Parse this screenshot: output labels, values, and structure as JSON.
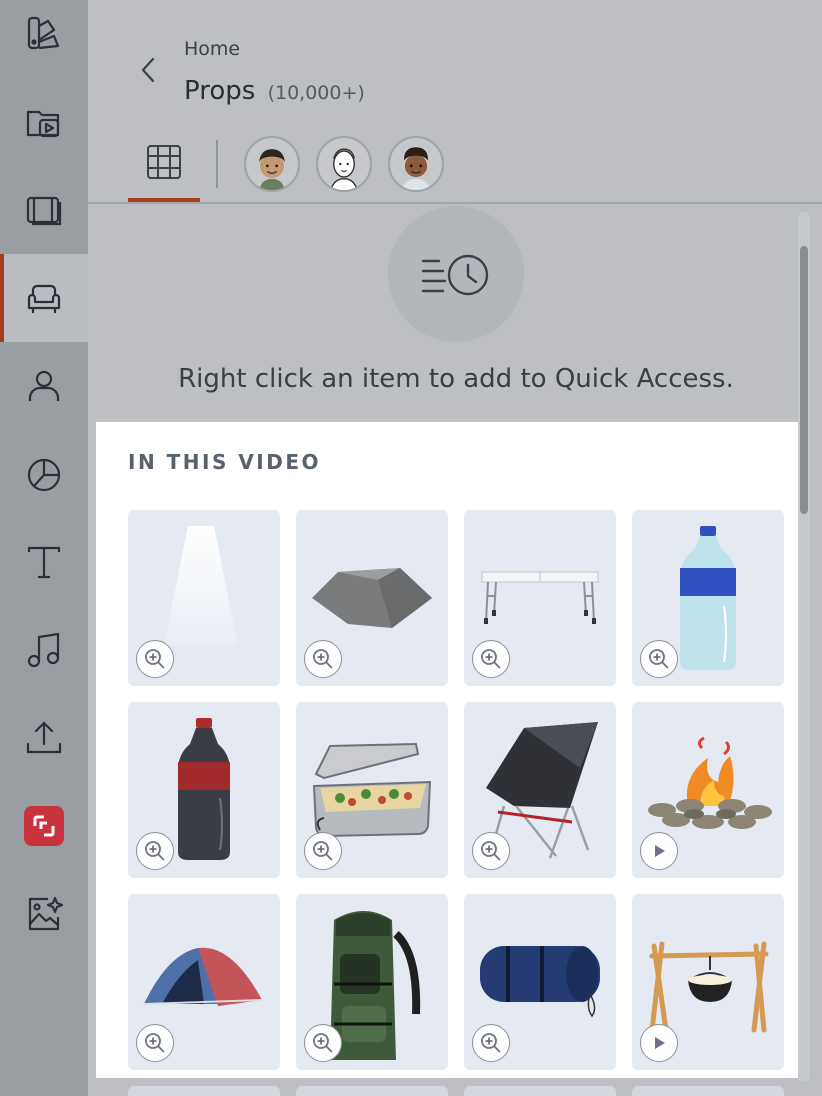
{
  "sidebar": {
    "items": [
      {
        "icon": "palette-icon"
      },
      {
        "icon": "video-folder-icon"
      },
      {
        "icon": "film-strip-icon"
      },
      {
        "icon": "armchair-icon",
        "active": true
      },
      {
        "icon": "person-icon"
      },
      {
        "icon": "pie-chart-icon"
      },
      {
        "icon": "text-icon"
      },
      {
        "icon": "music-note-icon"
      },
      {
        "icon": "upload-icon"
      },
      {
        "icon": "brand-app-icon",
        "color": "#c8333c"
      },
      {
        "icon": "ai-image-icon"
      }
    ]
  },
  "header": {
    "breadcrumb": "Home",
    "title": "Props",
    "count": "(10,000+)"
  },
  "tabs": [
    {
      "icon": "grid-icon",
      "active": true
    },
    {
      "icon": "avatar-style-1"
    },
    {
      "icon": "avatar-style-2"
    },
    {
      "icon": "avatar-style-3"
    }
  ],
  "quick_access": {
    "message": "Right click an item to add to Quick Access."
  },
  "section": {
    "title": "IN THIS VIDEO"
  },
  "props": [
    {
      "item": "spotlight-beam",
      "action": "zoom-icon"
    },
    {
      "item": "rock",
      "action": "zoom-icon"
    },
    {
      "item": "folding-table",
      "action": "zoom-icon"
    },
    {
      "item": "water-bottle",
      "action": "zoom-icon"
    },
    {
      "item": "soda-bottle",
      "action": "zoom-icon"
    },
    {
      "item": "food-container",
      "action": "zoom-icon"
    },
    {
      "item": "camping-chair",
      "action": "zoom-icon"
    },
    {
      "item": "campfire",
      "action": "play-icon"
    },
    {
      "item": "tent",
      "action": "zoom-icon"
    },
    {
      "item": "hiking-backpack",
      "action": "zoom-icon"
    },
    {
      "item": "sleeping-bag",
      "action": "zoom-icon"
    },
    {
      "item": "cooking-pot-over-fire",
      "action": "play-icon"
    }
  ],
  "colors": {
    "accent": "#a23e1f",
    "tile_bg": "#e4e9f2",
    "section_bg": "#ffffff"
  }
}
